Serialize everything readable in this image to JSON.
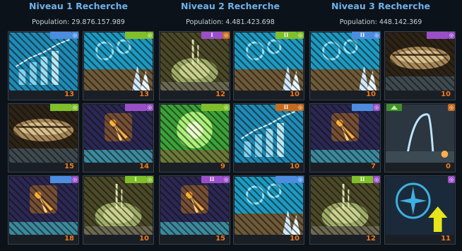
{
  "columns": [
    {
      "title": "Niveau 1 Recherche",
      "population": "Population: 29.876.157.989"
    },
    {
      "title": "Niveau 2 Recherche",
      "population": "Population: 4.481.423.698"
    },
    {
      "title": "Niveau 3 Recherche",
      "population": "Population: 448.142.369"
    }
  ],
  "tiles": [
    {
      "level": "13",
      "art": "chart",
      "tier": "",
      "tier_color": "#4c8de0",
      "dot_color": "#4c8de0"
    },
    {
      "level": "13",
      "art": "crystal",
      "tier": "",
      "tier_color": "#7fbf2a",
      "dot_color": "#7fbf2a"
    },
    {
      "level": "12",
      "art": "dome",
      "tier": "I",
      "tier_color": "#9a4fc9",
      "dot_color": "#c86a1e"
    },
    {
      "level": "10",
      "art": "crystal",
      "tier": "II",
      "tier_color": "#7fbf2a",
      "dot_color": "#7fbf2a"
    },
    {
      "level": "10",
      "art": "crystal",
      "tier": "II",
      "tier_color": "#4c8de0",
      "dot_color": "#4c8de0"
    },
    {
      "level": "10",
      "art": "ship",
      "tier": "",
      "tier_color": "#9a4fc9",
      "dot_color": "#9a4fc9"
    },
    {
      "level": "15",
      "art": "ship",
      "tier": "",
      "tier_color": "#7fbf2a",
      "dot_color": "#7fbf2a"
    },
    {
      "level": "14",
      "art": "comet",
      "tier": "",
      "tier_color": "#9a4fc9",
      "dot_color": "#9a4fc9"
    },
    {
      "level": "9",
      "art": "green",
      "tier": "",
      "tier_color": "#7fbf2a",
      "dot_color": "#7fbf2a"
    },
    {
      "level": "10",
      "art": "chart",
      "tier": "II",
      "tier_color": "#c86a1e",
      "dot_color": "#c86a1e"
    },
    {
      "level": "7",
      "art": "comet",
      "tier": "",
      "tier_color": "#4c8de0",
      "dot_color": "#9a4fc9"
    },
    {
      "level": "0",
      "art": "beam",
      "tier": "",
      "tier_color": "",
      "dot_color": "#c86a1e"
    },
    {
      "level": "18",
      "art": "comet",
      "tier": "",
      "tier_color": "#4c8de0",
      "dot_color": "#9a4fc9"
    },
    {
      "level": "10",
      "art": "dome",
      "tier": "I",
      "tier_color": "#7fbf2a",
      "dot_color": "#7fbf2a"
    },
    {
      "level": "15",
      "art": "comet",
      "tier": "II",
      "tier_color": "#9a4fc9",
      "dot_color": "#9a4fc9"
    },
    {
      "level": "10",
      "art": "crystal",
      "tier": "",
      "tier_color": "#4c8de0",
      "dot_color": "#4c8de0"
    },
    {
      "level": "12",
      "art": "dome",
      "tier": "II",
      "tier_color": "#7fbf2a",
      "dot_color": "#9a4fc9"
    },
    {
      "level": "11",
      "art": "compass",
      "tier": "",
      "tier_color": "",
      "dot_color": "#9a4fc9"
    }
  ],
  "colors": {
    "title": "#6fb1e8",
    "level": "#f07a1a",
    "background": "#0b1219"
  }
}
